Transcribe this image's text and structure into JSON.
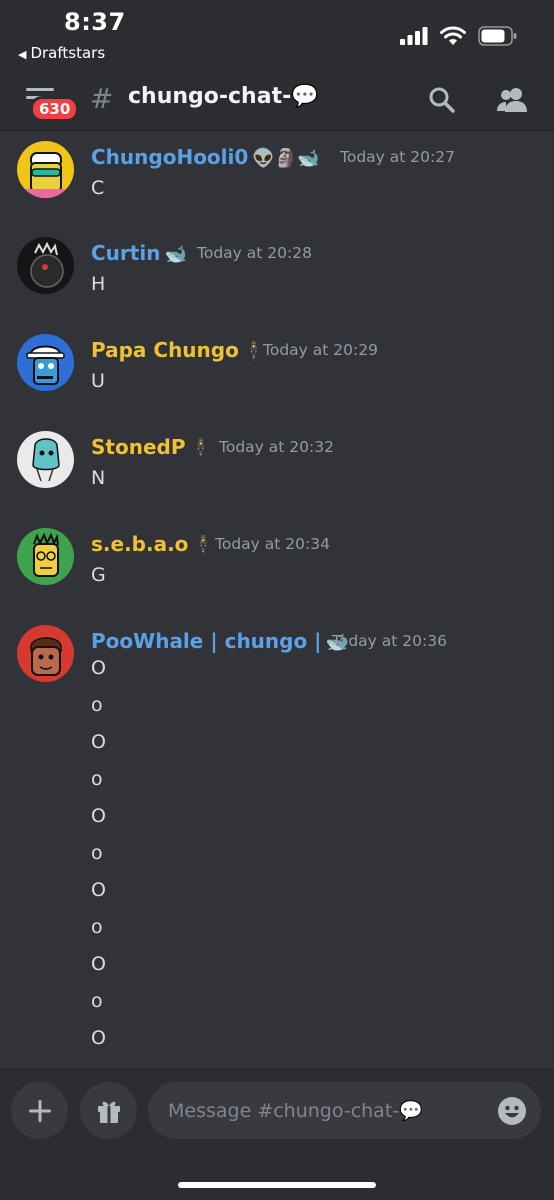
{
  "status_bar": {
    "time": "8:37",
    "back_app": "Draftstars"
  },
  "header": {
    "badge_count": "630",
    "channel_name": "chungo-chat-💬",
    "icons": [
      "menu-icon",
      "hash-icon",
      "search-icon",
      "members-icon"
    ]
  },
  "messages": [
    {
      "username": "ChungoHooli0",
      "name_color": "#5aa2e8",
      "emojis": "👽🗿🐋",
      "timestamp": "Today at 20:27",
      "lines": [
        "C"
      ],
      "avatar_color": "#f0c419"
    },
    {
      "username": "Curtin",
      "name_color": "#5aa2e8",
      "emojis": "🐋",
      "timestamp": "Today at 20:28",
      "lines": [
        "H"
      ],
      "avatar_color": "#111111"
    },
    {
      "username": "Papa Chungo",
      "name_color": "#f0c232",
      "emojis": "🕴",
      "timestamp": "Today at 20:29",
      "lines": [
        "U"
      ],
      "avatar_color": "#2d6fd6"
    },
    {
      "username": "StonedP",
      "name_color": "#f0c232",
      "emojis": "🕴",
      "timestamp": "Today at 20:32",
      "lines": [
        "N"
      ],
      "avatar_color": "#e8e8e8"
    },
    {
      "username": "s.e.b.a.o",
      "name_color": "#f0c232",
      "emojis": "🕴",
      "timestamp": "Today at 20:34",
      "lines": [
        "G"
      ],
      "avatar_color": "#3fa34d"
    },
    {
      "username": "PooWhale | chungo |",
      "name_color": "#5aa2e8",
      "emojis": "🐋",
      "timestamp": "Today at 20:36",
      "lines": [
        "O",
        "o",
        "O",
        "o",
        "O",
        "o",
        "O",
        "o",
        "O",
        "o",
        "O"
      ],
      "avatar_color": "#d63a2f"
    }
  ],
  "composer": {
    "placeholder": "Message #chungo-chat-💬"
  }
}
